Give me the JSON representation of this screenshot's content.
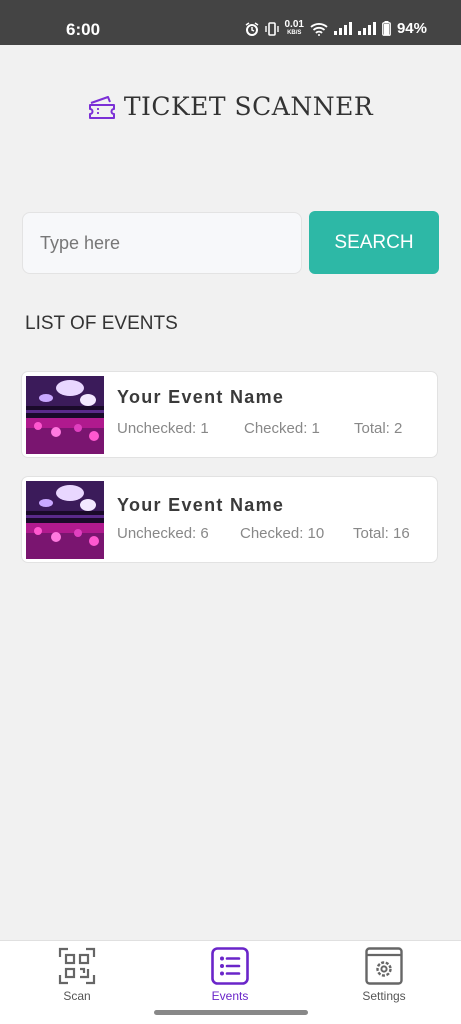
{
  "status_bar": {
    "time": "6:00",
    "net_speed": "0.01",
    "net_unit": "KB/S",
    "battery": "94%"
  },
  "header": {
    "title": "TICKET SCANNER",
    "icon": "ticket-icon",
    "icon_color": "#7b2fd6"
  },
  "search": {
    "placeholder": "Type here",
    "value": "",
    "button_label": "SEARCH",
    "button_color": "#2db8a6"
  },
  "events_section": {
    "title": "LIST OF EVENTS"
  },
  "events": [
    {
      "name": "Your Event Name",
      "unchecked": "Unchecked: 1",
      "checked": "Checked: 1",
      "total": "Total: 2"
    },
    {
      "name": "Your Event Name",
      "unchecked": "Unchecked: 6",
      "checked": "Checked: 10",
      "total": "Total: 16"
    }
  ],
  "bottom_nav": {
    "items": [
      {
        "label": "Scan",
        "icon": "qr-code-icon"
      },
      {
        "label": "Events",
        "icon": "list-icon",
        "active": true
      },
      {
        "label": "Settings",
        "icon": "settings-gear-icon"
      }
    ],
    "active_color": "#6a25c9"
  }
}
